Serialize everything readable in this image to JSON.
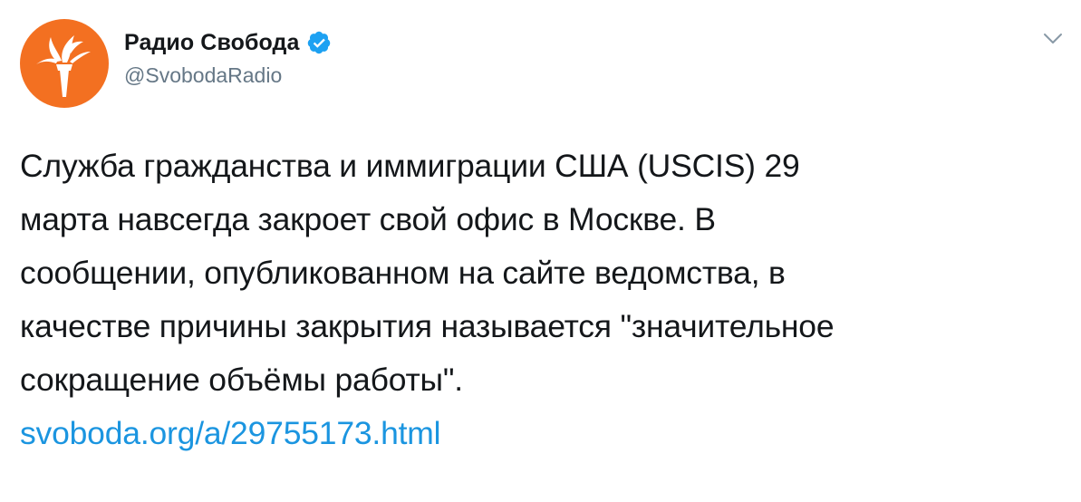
{
  "author": {
    "display_name": "Радио Свобода",
    "handle": "@SvobodaRadio",
    "verified": true,
    "avatar_color": "#f37021"
  },
  "icons": {
    "verified": "verified-badge-icon",
    "menu": "chevron-down-icon",
    "avatar_logo": "torch-logo"
  },
  "tweet": {
    "lines": [
      "Служба гражданства и иммиграции США (USCIS) 29",
      "марта навсегда закроет свой офис в Москве. В",
      "сообщении, опубликованном на сайте ведомства, в",
      "качестве причины закрытия называется \"значительное",
      "сокращение объёмы работы\"."
    ],
    "link": "svoboda.org/a/29755173.html"
  },
  "colors": {
    "text": "#14171a",
    "secondary": "#657786",
    "link": "#1b95e0",
    "verified": "#1da1f2"
  }
}
